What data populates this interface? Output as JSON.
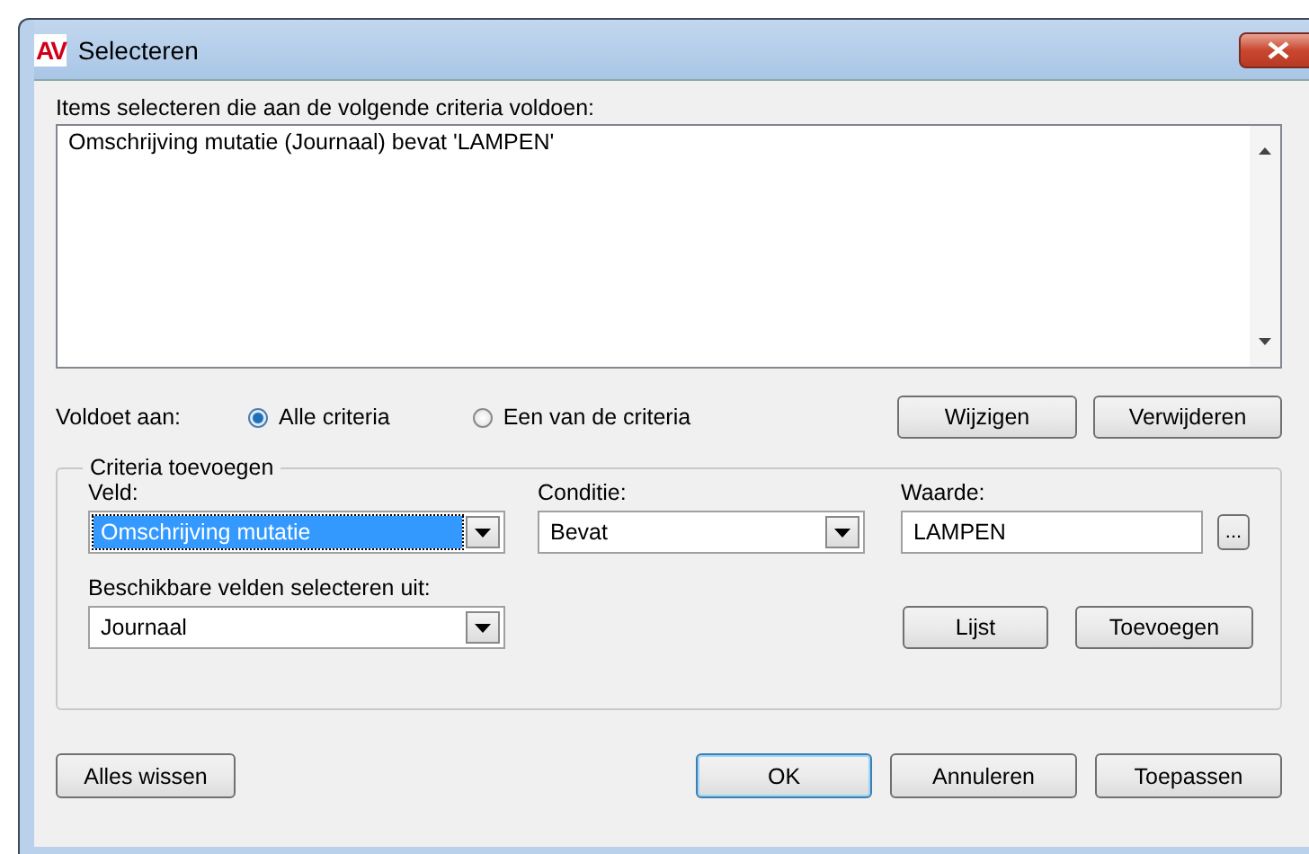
{
  "window": {
    "logo": "AV",
    "title": "Selecteren"
  },
  "criteria_list": {
    "label": "Items selecteren die aan de volgende criteria voldoen:",
    "items": [
      "Omschrijving mutatie (Journaal) bevat 'LAMPEN'"
    ]
  },
  "match": {
    "label": "Voldoet aan:",
    "options": [
      {
        "label": "Alle criteria",
        "selected": true
      },
      {
        "label": "Een van de criteria",
        "selected": false
      }
    ]
  },
  "list_buttons": [
    "Wijzigen",
    "Verwijderen"
  ],
  "add_group": {
    "title": "Criteria toevoegen",
    "field": {
      "label": "Veld:",
      "value": "Omschrijving mutatie",
      "focused": true
    },
    "condition": {
      "label": "Conditie:",
      "value": "Bevat"
    },
    "value": {
      "label": "Waarde:",
      "value": "LAMPEN",
      "browse": "..."
    },
    "source": {
      "label": "Beschikbare velden selecteren uit:",
      "value": "Journaal"
    },
    "buttons": [
      "Lijst",
      "Toevoegen"
    ]
  },
  "footer": {
    "left": "Alles wissen",
    "buttons": [
      {
        "label": "OK",
        "default": true
      },
      {
        "label": "Annuleren",
        "default": false
      },
      {
        "label": "Toepassen",
        "default": false
      }
    ]
  }
}
